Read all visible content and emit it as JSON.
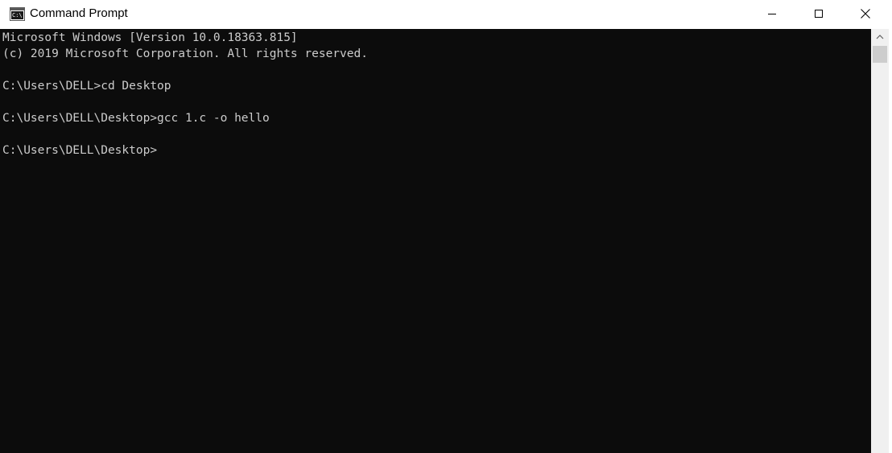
{
  "window": {
    "title": "Command Prompt",
    "icon": "cmd-icon",
    "icon_text": "C:\\."
  },
  "console": {
    "lines": [
      "Microsoft Windows [Version 10.0.18363.815]",
      "(c) 2019 Microsoft Corporation. All rights reserved.",
      "",
      "C:\\Users\\DELL>cd Desktop",
      "",
      "C:\\Users\\DELL\\Desktop>gcc 1.c -o hello",
      "",
      "C:\\Users\\DELL\\Desktop>"
    ]
  },
  "colors": {
    "console_bg": "#0c0c0c",
    "console_text": "#cccccc",
    "titlebar_bg": "#ffffff"
  }
}
